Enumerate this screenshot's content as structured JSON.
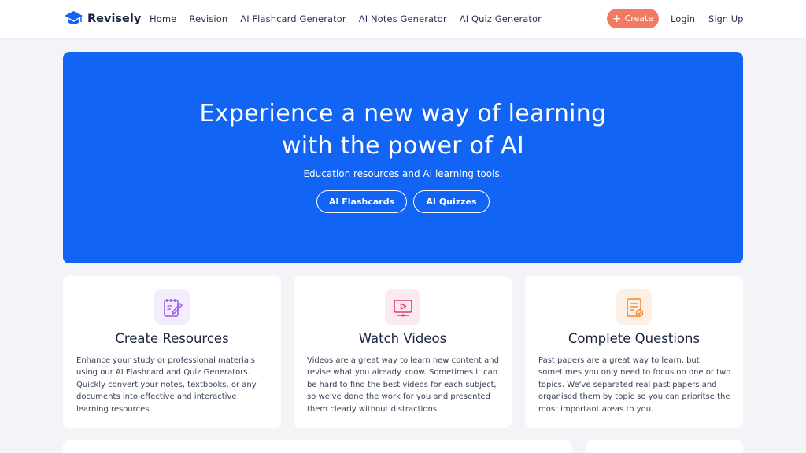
{
  "brand": {
    "name": "Revisely",
    "icon": "graduation-cap-icon",
    "color": "#1264f5"
  },
  "nav": {
    "links": [
      "Home",
      "Revision",
      "AI Flashcard Generator",
      "AI Notes Generator",
      "AI Quiz Generator"
    ],
    "create_label": "Create",
    "login_label": "Login",
    "signup_label": "Sign Up"
  },
  "hero": {
    "title_line1": "Experience a new way of learning",
    "title_line2": "with the power of AI",
    "subtitle": "Education resources and AI learning tools.",
    "buttons": [
      "AI Flashcards",
      "AI Quizzes"
    ]
  },
  "cards": [
    {
      "icon": "notebook-pen-icon",
      "title": "Create Resources",
      "body": "Enhance your study or professional materials using our AI Flashcard and Quiz Generators. Quickly convert your notes, textbooks, or any documents into effective and interactive learning resources."
    },
    {
      "icon": "video-play-icon",
      "title": "Watch Videos",
      "body": "Videos are a great way to learn new content and revise what you already know. Sometimes it can be hard to find the best videos for each subject, so we've done the work for you and presented them clearly without distractions."
    },
    {
      "icon": "document-check-icon",
      "title": "Complete Questions",
      "body": "Past papers are a great way to learn, but sometimes you only need to focus on one or two topics. We've separated real past papers and organised them by topic so you can prioritse the most important areas to you."
    }
  ],
  "colors": {
    "hero_bg": "#1264f5",
    "create_btn": "#f27a62",
    "page_bg": "#f4f4f8"
  }
}
